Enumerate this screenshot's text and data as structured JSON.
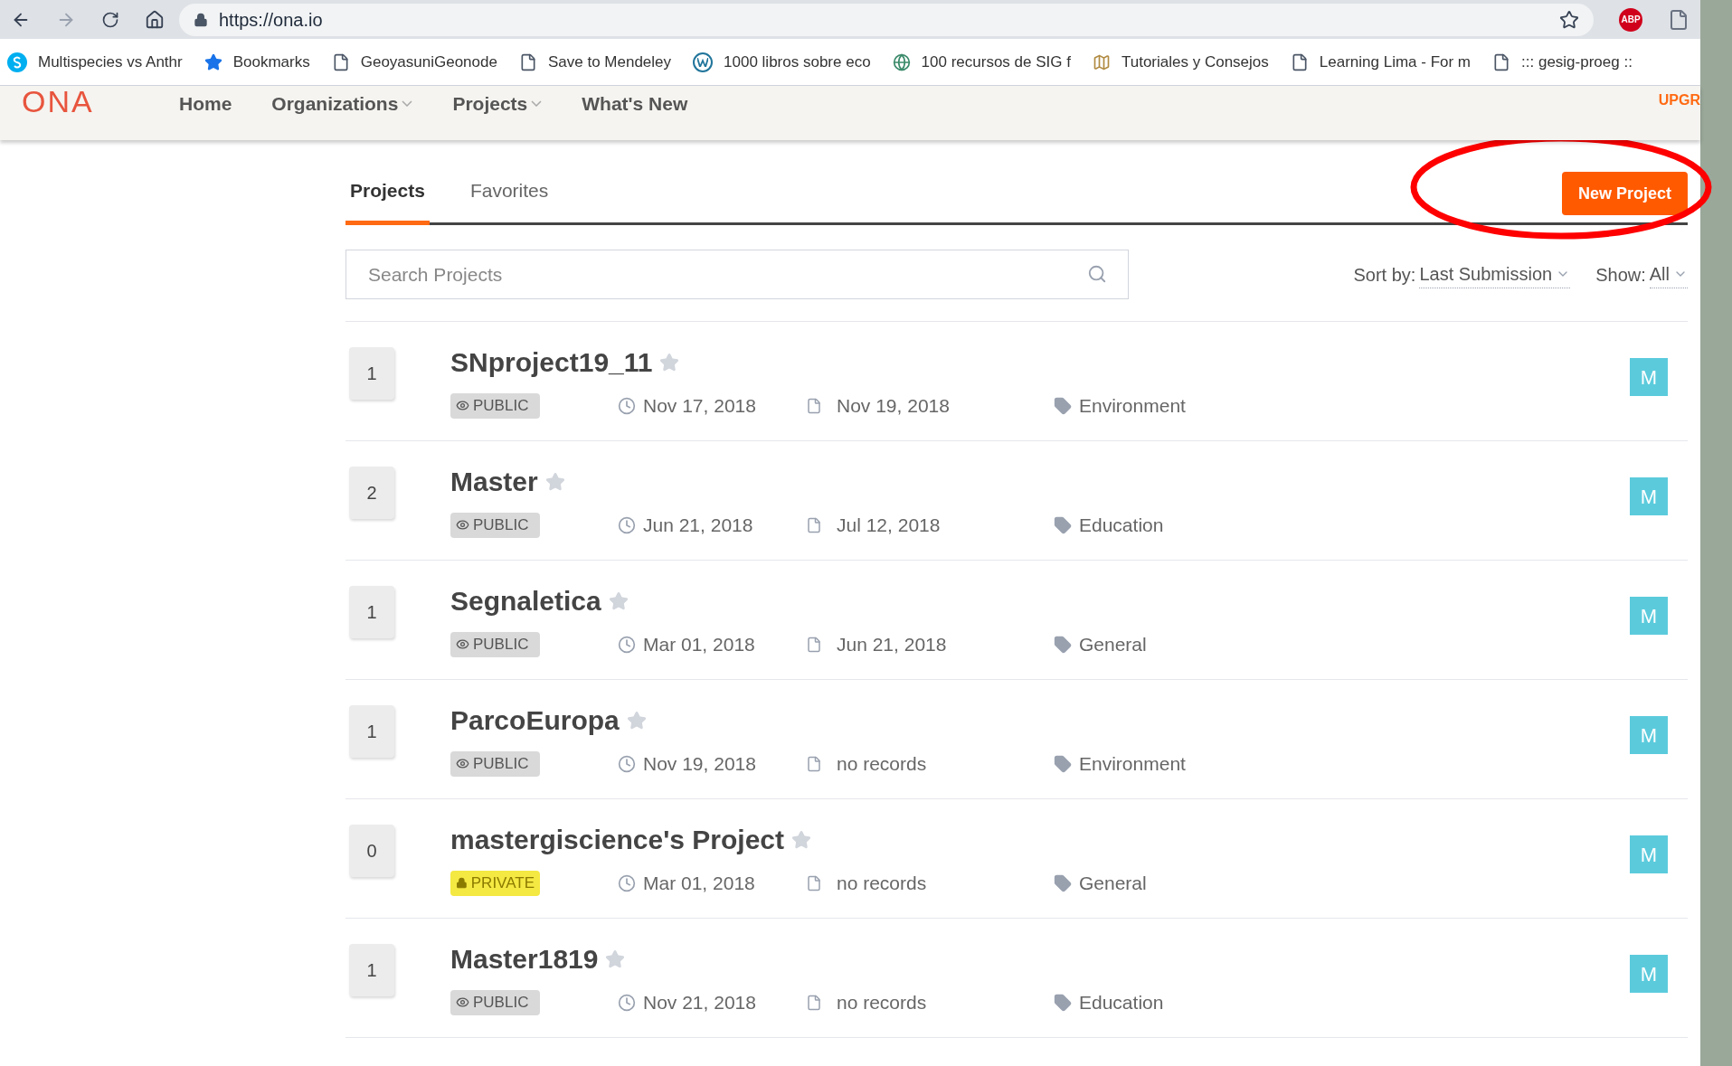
{
  "browser": {
    "url": "https://ona.io",
    "bookmarks": [
      {
        "kind": "skype",
        "label": "Multispecies vs Anthr"
      },
      {
        "kind": "star",
        "label": "Bookmarks"
      },
      {
        "kind": "page",
        "label": "GeoyasuniGeonode"
      },
      {
        "kind": "page",
        "label": "Save to Mendeley"
      },
      {
        "kind": "wordpress",
        "label": "1000 libros sobre eco"
      },
      {
        "kind": "globe",
        "label": "100 recursos de SIG f"
      },
      {
        "kind": "map",
        "label": "Tutoriales y Consejos"
      },
      {
        "kind": "page",
        "label": "Learning Lima - For m"
      },
      {
        "kind": "page",
        "label": "::: gesig-proeg ::"
      }
    ],
    "extension_label": "ABP"
  },
  "nav": {
    "logo": "ONA",
    "items": [
      {
        "label": "Home",
        "dropdown": false
      },
      {
        "label": "Organizations",
        "dropdown": true
      },
      {
        "label": "Projects",
        "dropdown": true
      },
      {
        "label": "What's New",
        "dropdown": false
      }
    ],
    "upgrade": "UPGR"
  },
  "tabs": [
    {
      "label": "Projects",
      "selected": true
    },
    {
      "label": "Favorites",
      "selected": false
    }
  ],
  "new_project_button": "New Project",
  "search": {
    "placeholder": "Search Projects"
  },
  "sort": {
    "label": "Sort by:",
    "value": "Last Submission"
  },
  "show": {
    "label": "Show:",
    "value": "All"
  },
  "projects": [
    {
      "forms": "1",
      "name": "SNproject19_11",
      "visibility": "PUBLIC",
      "kind": "public",
      "created": "Nov 17, 2018",
      "last_submission": "Nov 19, 2018",
      "category": "Environment",
      "avatar": "M"
    },
    {
      "forms": "2",
      "name": "Master",
      "visibility": "PUBLIC",
      "kind": "public",
      "created": "Jun 21, 2018",
      "last_submission": "Jul 12, 2018",
      "category": "Education",
      "avatar": "M"
    },
    {
      "forms": "1",
      "name": "Segnaletica",
      "visibility": "PUBLIC",
      "kind": "public",
      "created": "Mar 01, 2018",
      "last_submission": "Jun 21, 2018",
      "category": "General",
      "avatar": "M"
    },
    {
      "forms": "1",
      "name": "ParcoEuropa",
      "visibility": "PUBLIC",
      "kind": "public",
      "created": "Nov 19, 2018",
      "last_submission": "no records",
      "category": "Environment",
      "avatar": "M"
    },
    {
      "forms": "0",
      "name": "mastergiscience's Project",
      "visibility": "PRIVATE",
      "kind": "private",
      "created": "Mar 01, 2018",
      "last_submission": "no records",
      "category": "General",
      "avatar": "M"
    },
    {
      "forms": "1",
      "name": "Master1819",
      "visibility": "PUBLIC",
      "kind": "public",
      "created": "Nov 21, 2018",
      "last_submission": "no records",
      "category": "Education",
      "avatar": "M"
    }
  ]
}
